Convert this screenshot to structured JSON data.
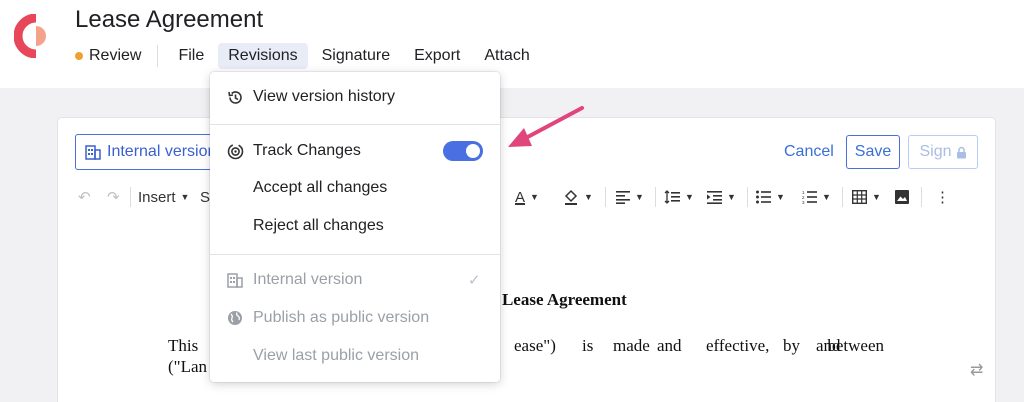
{
  "app": {
    "brand_color": "#e8475a",
    "accent_color": "#3a6fd8"
  },
  "header": {
    "title": "Lease Agreement"
  },
  "menubar": {
    "status_label": "Review",
    "status_color": "#f0a030",
    "items": [
      {
        "label": "File"
      },
      {
        "label": "Revisions"
      },
      {
        "label": "Signature"
      },
      {
        "label": "Export"
      },
      {
        "label": "Attach"
      }
    ]
  },
  "action_bar": {
    "internal_version_label": "Internal version",
    "cancel_label": "Cancel",
    "save_label": "Save",
    "sign_label": "Sign"
  },
  "toolbar": {
    "insert_label": "Insert",
    "style_label": "S"
  },
  "revisions_menu": {
    "items": [
      {
        "label": "View version history",
        "icon": "history-icon",
        "enabled": true
      },
      {
        "label": "Track Changes",
        "icon": "track-changes-icon",
        "enabled": true,
        "toggle_on": true
      },
      {
        "label": "Accept all changes",
        "enabled": true
      },
      {
        "label": "Reject all changes",
        "enabled": true
      },
      {
        "label": "Internal version",
        "icon": "building-icon",
        "enabled": false,
        "checked": true
      },
      {
        "label": "Publish as public version",
        "icon": "globe-icon",
        "enabled": false
      },
      {
        "label": "View last public version",
        "enabled": false
      }
    ]
  },
  "document": {
    "heading_fragment": "l Lease Agreement",
    "line1_words": [
      "This",
      "ease\")",
      "is",
      "made",
      "and",
      "effective,",
      "by",
      "and",
      "between"
    ],
    "line2_fragment": "(\"Lan"
  }
}
